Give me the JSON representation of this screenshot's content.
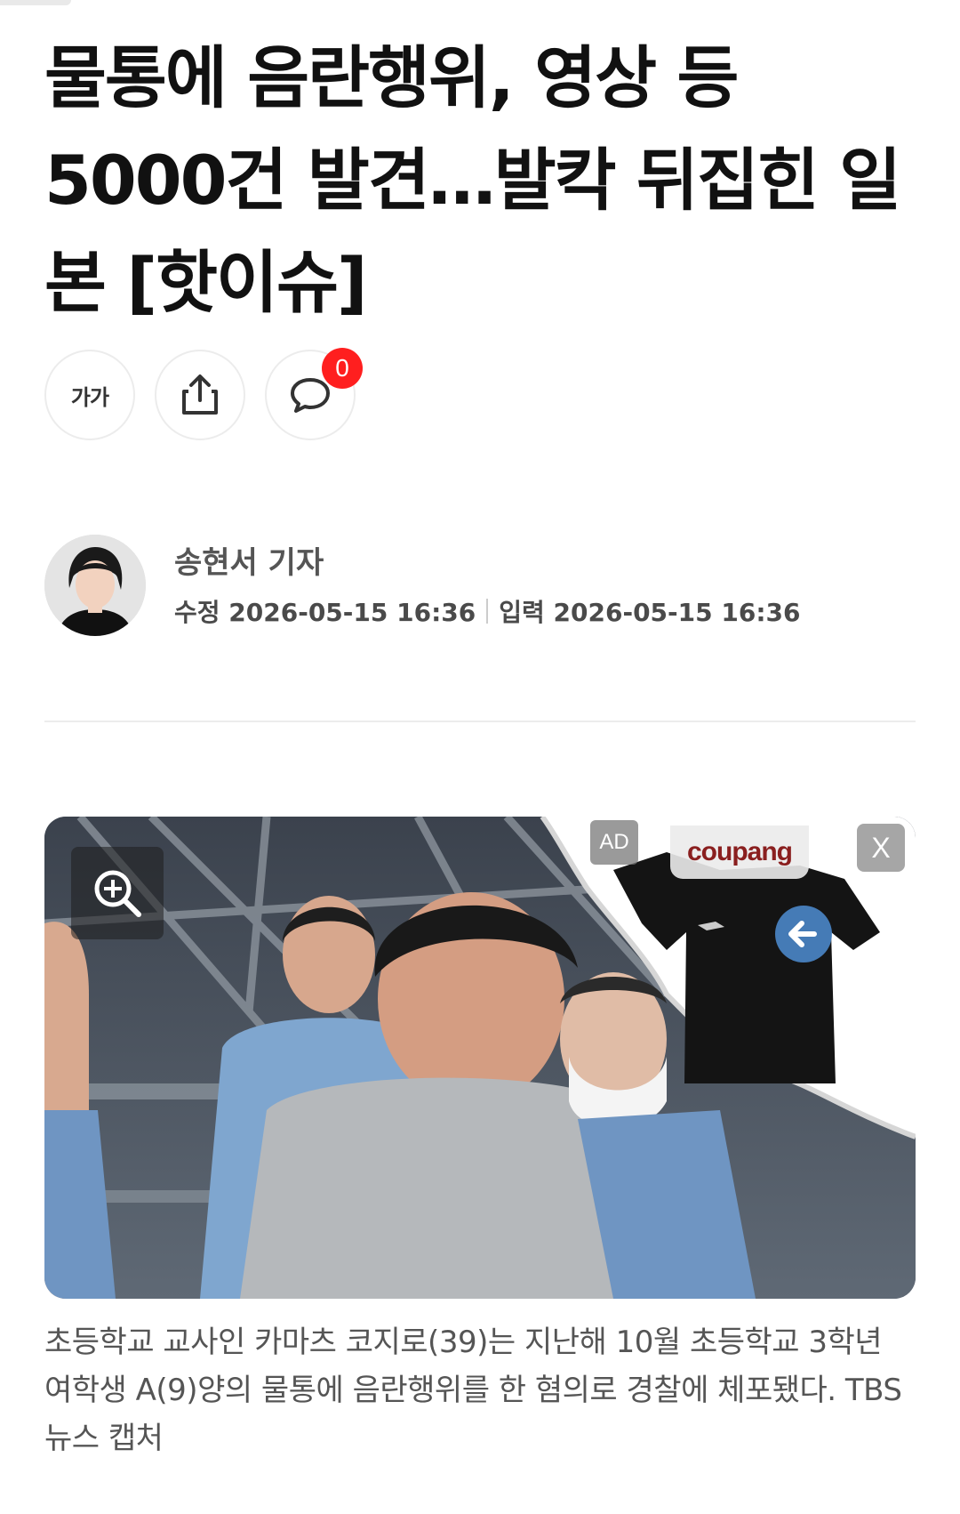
{
  "article": {
    "headline": "물통에 음란행위, 영상 등 5000건 발견…발칵 뒤집힌 일본 [핫이슈]"
  },
  "actions": {
    "font_size_label": "가가",
    "comment_count": "0"
  },
  "byline": {
    "author": "송현서 기자",
    "modified": "수정 2026-05-15 16:36",
    "published": "입력 2026-05-15 16:36"
  },
  "photo": {
    "caption": "초등학교 교사인 카마츠 코지로(39)는 지난해 10월 초등학교 3학년 여학생 A(9)양의 물통에 음란행위를 한 혐의로 경찰에 체포됐다. TBS 뉴스 캡처"
  },
  "ad": {
    "label": "AD",
    "brand": "coupang",
    "close_label": "X"
  },
  "colors": {
    "badge": "#ff1f1f",
    "text": "#111111",
    "muted": "#555555",
    "divider": "#ececec"
  },
  "icons": [
    "zoom-in-icon",
    "share-icon",
    "comment-icon",
    "back-arrow-icon"
  ]
}
